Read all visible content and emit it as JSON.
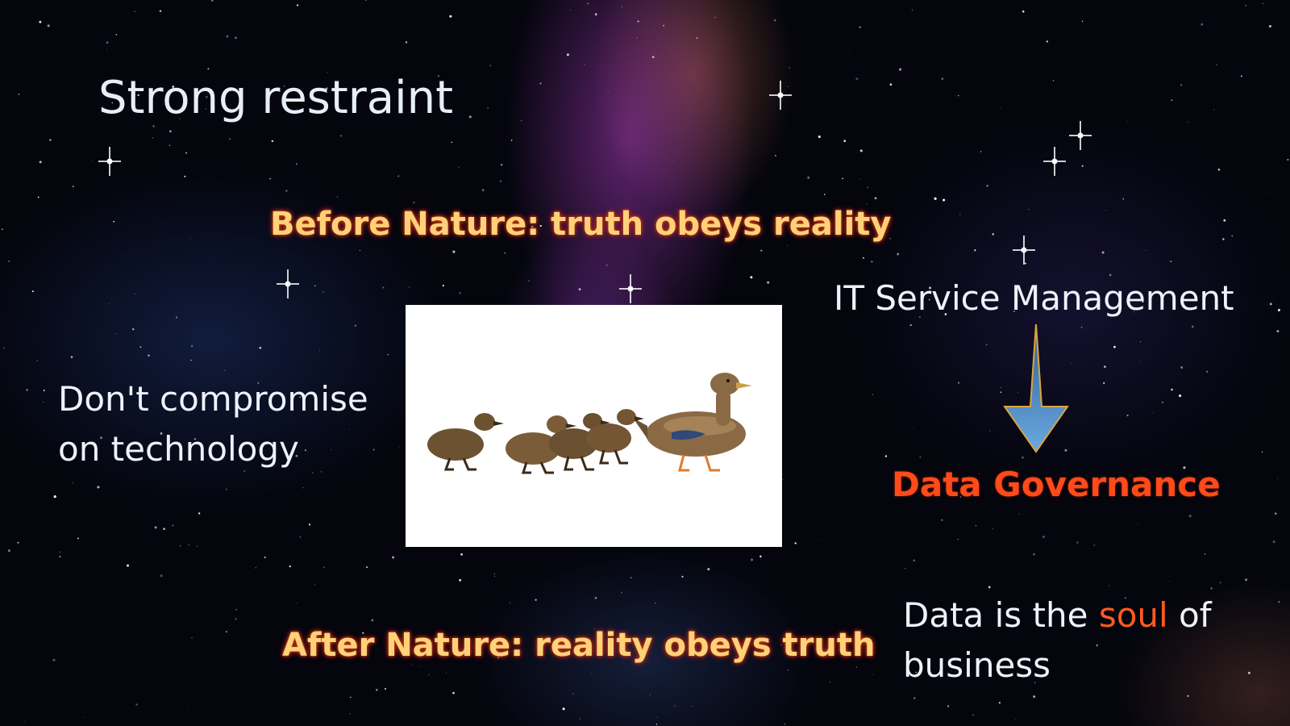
{
  "slide": {
    "title": "Strong restraint",
    "before_nature": "Before Nature: truth obeys reality",
    "after_nature": "After Nature: reality obeys truth",
    "left_text_line1": "Don't compromise",
    "left_text_line2": "on technology",
    "itsm": "IT Service Management",
    "data_governance": "Data Governance",
    "soul_prefix": "Data is the ",
    "soul_word": "soul",
    "soul_suffix": " of",
    "soul_line2": "business"
  },
  "colors": {
    "glow_text": "#ffd27a",
    "accent": "#ff5a1f",
    "arrow": "#5b9bd5"
  },
  "photo": {
    "description_icon": "duck-family-illustration"
  }
}
